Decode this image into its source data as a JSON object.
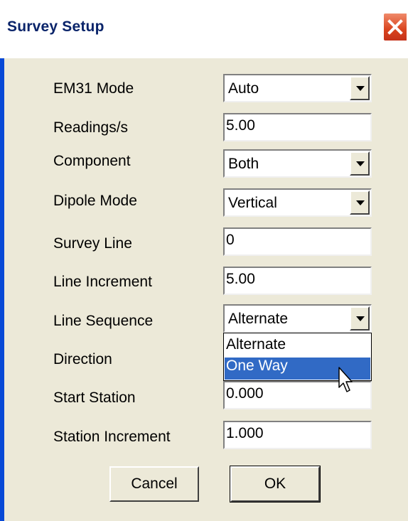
{
  "window": {
    "title": "Survey Setup"
  },
  "form": {
    "em31_mode_label": "EM31 Mode",
    "em31_mode_value": "Auto",
    "readings_label": "Readings/s",
    "readings_value": "5.00",
    "component_label": "Component",
    "component_value": "Both",
    "dipole_label": "Dipole Mode",
    "dipole_value": "Vertical",
    "survey_line_label": "Survey Line",
    "survey_line_value": "0",
    "line_increment_label": "Line Increment",
    "line_increment_value": "5.00",
    "line_sequence_label": "Line Sequence",
    "line_sequence_value": "Alternate",
    "direction_label": "Direction",
    "start_station_label": "Start Station",
    "start_station_value": "0.000",
    "station_increment_label": "Station Increment",
    "station_increment_value": "1.000"
  },
  "dropdown": {
    "options": [
      "Alternate",
      "One Way"
    ],
    "highlighted": "One Way"
  },
  "buttons": {
    "cancel": "Cancel",
    "ok": "OK"
  },
  "colors": {
    "title_text": "#0a246a",
    "selection": "#316ac5",
    "dialog_bg": "#ece9d8",
    "frame": "#0849d6",
    "close_button": "#d9431e"
  },
  "icons": [
    "close-icon",
    "chevron-down-icon",
    "mouse-cursor-icon"
  ]
}
